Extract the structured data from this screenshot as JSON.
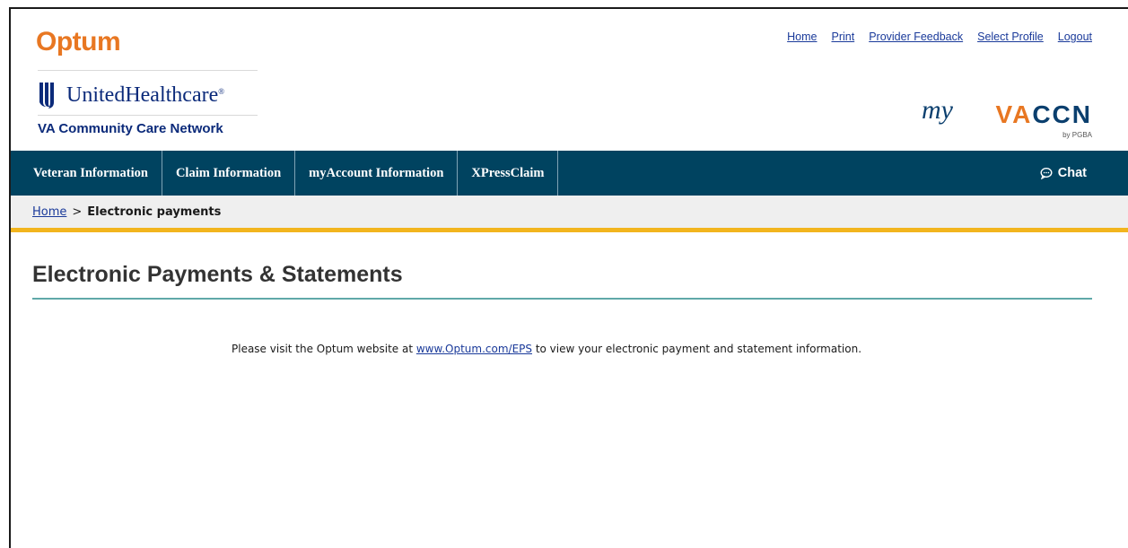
{
  "header": {
    "logo_optum": "Optum",
    "logo_uhc": "UnitedHealthcare",
    "logo_vaccn": "VA Community Care Network",
    "brand_my": "my",
    "brand_va": "VA",
    "brand_ccn": "CCN",
    "brand_by": "by PGBA",
    "top_links": {
      "home": "Home",
      "print": "Print",
      "feedback": "Provider Feedback",
      "profile": "Select Profile",
      "logout": "Logout"
    }
  },
  "nav": {
    "items": [
      "Veteran Information",
      "Claim Information",
      "myAccount Information",
      "XPressClaim"
    ],
    "chat": "Chat"
  },
  "breadcrumb": {
    "home": "Home",
    "separator": ">",
    "current": "Electronic payments"
  },
  "main": {
    "title": "Electronic Payments & Statements",
    "message_before": "Please visit the Optum website at ",
    "message_link": "www.Optum.com/EPS",
    "message_after": " to view your electronic payment and statement information."
  },
  "colors": {
    "nav_bg": "#004360",
    "optum_orange": "#e87722",
    "uhc_blue": "#0b2a7a",
    "gold_bar": "#f2b51e",
    "title_rule": "#5fa8a8",
    "link": "#1a3a9a"
  },
  "icons": {
    "uhc_logo": "uhc-shield-icon",
    "chat": "chat-bubble-icon"
  }
}
